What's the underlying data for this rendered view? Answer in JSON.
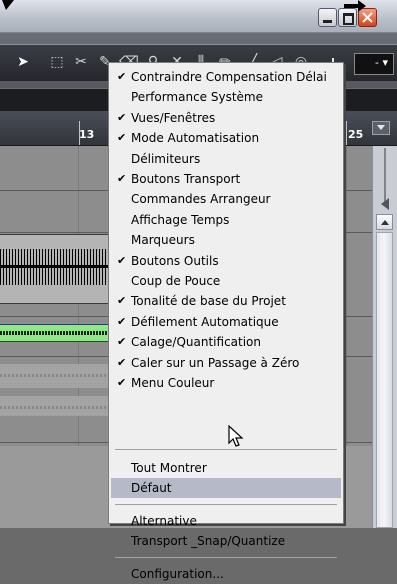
{
  "ruler": {
    "marker_13": "13",
    "marker_25": "25"
  },
  "menu": {
    "items": [
      {
        "label": "Contraindre Compensation Délai",
        "checked": true
      },
      {
        "label": "Performance Système",
        "checked": false
      },
      {
        "label": "Vues/Fenêtres",
        "checked": true
      },
      {
        "label": "Mode Automatisation",
        "checked": true
      },
      {
        "label": "Délimiteurs",
        "checked": false
      },
      {
        "label": "Boutons Transport",
        "checked": true
      },
      {
        "label": "Commandes Arrangeur",
        "checked": false
      },
      {
        "label": "Affichage Temps",
        "checked": false
      },
      {
        "label": "Marqueurs",
        "checked": false
      },
      {
        "label": "Boutons Outils",
        "checked": true
      },
      {
        "label": "Coup de Pouce",
        "checked": false
      },
      {
        "label": "Tonalité de base du Projet",
        "checked": true
      },
      {
        "label": "Défilement Automatique",
        "checked": true
      },
      {
        "label": "Calage/Quantification",
        "checked": true
      },
      {
        "label": "Caler sur un Passage à Zéro",
        "checked": true
      },
      {
        "label": "Menu Couleur",
        "checked": true
      }
    ],
    "group2": [
      "Tout Montrer",
      "Défaut"
    ],
    "group3": [
      "Alternative",
      "Transport _Snap/Quantize"
    ],
    "group4": [
      "Configuration..."
    ],
    "check_glyph": "✔",
    "highlighted": "Défaut"
  },
  "colors": {
    "highlight": "#b6b9c8",
    "event_green": "#8fe68b",
    "close_button": "#d4431f"
  }
}
